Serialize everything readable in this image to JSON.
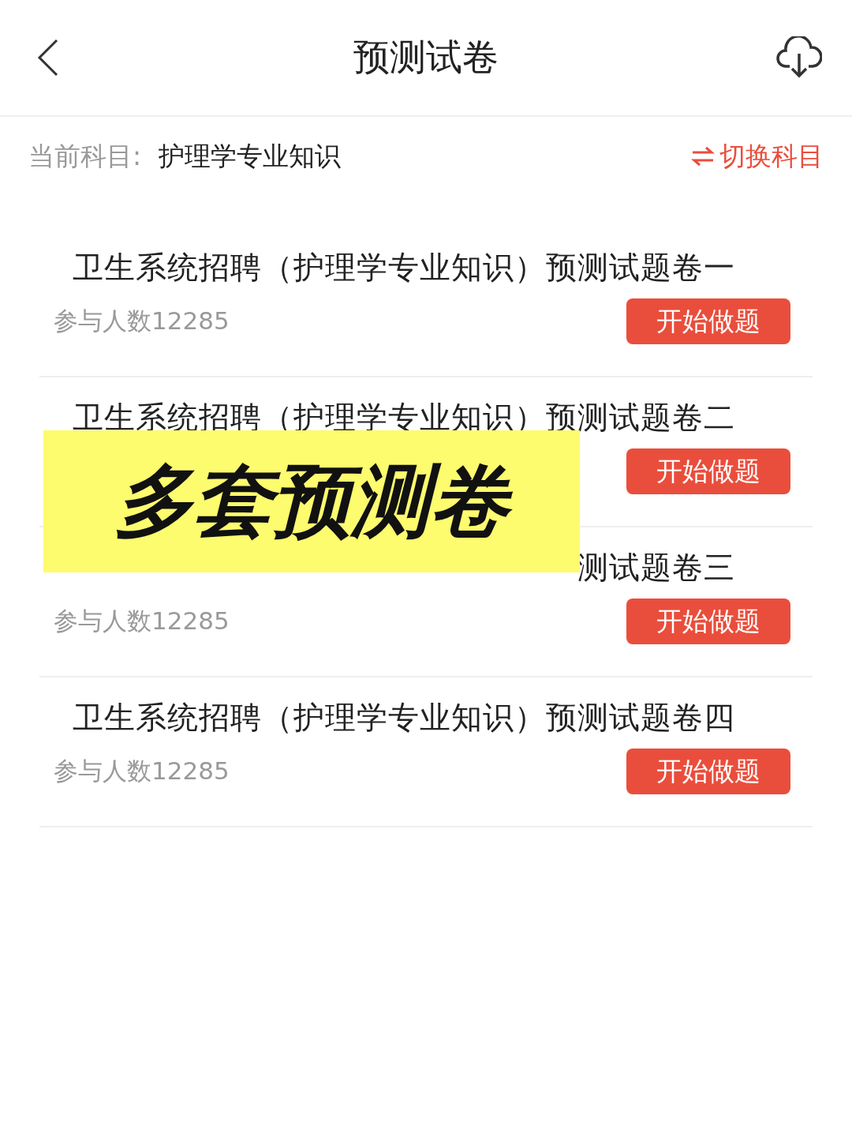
{
  "header": {
    "title": "预测试卷"
  },
  "subject": {
    "label": "当前科目:",
    "value": "护理学专业知识",
    "switch": "切换科目"
  },
  "papers": [
    {
      "title": "卫生系统招聘（护理学专业知识）预测试题卷一",
      "count": "参与人数12285",
      "button": "开始做题"
    },
    {
      "title": "卫生系统招聘（护理学专业知识）预测试题卷二",
      "button": "开始做题"
    },
    {
      "title": "测试题卷三",
      "count": "参与人数12285",
      "button": "开始做题"
    },
    {
      "title": "卫生系统招聘（护理学专业知识）预测试题卷四",
      "count": "参与人数12285",
      "button": "开始做题"
    }
  ],
  "banner": {
    "text": "多套预测卷"
  }
}
